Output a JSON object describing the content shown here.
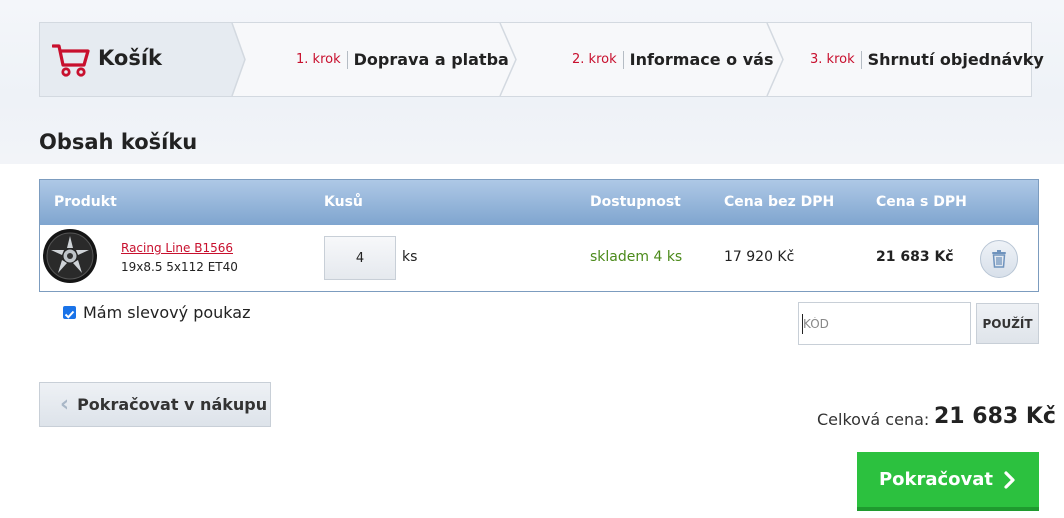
{
  "steps": {
    "cart_title": "Košík",
    "items": [
      {
        "num": "1. krok",
        "label": "Doprava a platba"
      },
      {
        "num": "2. krok",
        "label": "Informace o vás"
      },
      {
        "num": "3. krok",
        "label": "Shrnutí objednávky"
      }
    ]
  },
  "section_title": "Obsah košíku",
  "table": {
    "headers": {
      "product": "Produkt",
      "qty": "Kusů",
      "availability": "Dostupnost",
      "price_net": "Cena bez DPH",
      "price_gross": "Cena s DPH"
    },
    "rows": [
      {
        "name": "Racing Line B1566",
        "spec": "19x8.5 5x112 ET40",
        "qty": "4",
        "unit": "ks",
        "availability": "skladem 4 ks",
        "price_net": "17 920 Kč",
        "price_gross": "21 683 Kč"
      }
    ]
  },
  "voucher": {
    "checkbox_label": "Mám slevový poukaz",
    "checked": true,
    "code_placeholder": "KÓD",
    "apply_label": "POUŽÍT"
  },
  "back_button": "Pokračovat v nákupu",
  "total": {
    "label": "Celková cena:",
    "value": "21 683 Kč"
  },
  "continue_button": "Pokračovat",
  "colors": {
    "accent_red": "#c8102e",
    "header_blue": "#7fa5cf",
    "availability_green": "#4b8a1a",
    "continue_green": "#2cc13f"
  }
}
